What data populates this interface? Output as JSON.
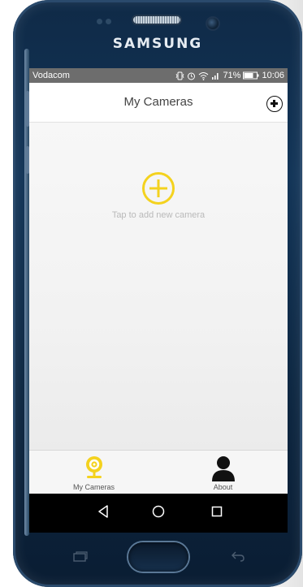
{
  "device": {
    "brand": "SAMSUNG"
  },
  "status_bar": {
    "carrier": "Vodacom",
    "battery": "71%",
    "time": "10:06"
  },
  "app_bar": {
    "title": "My Cameras",
    "add_icon": "plus-circle-icon"
  },
  "empty_state": {
    "icon": "plus-circle-icon",
    "text": "Tap to add new camera"
  },
  "tab_bar": {
    "tabs": [
      {
        "label": "My Cameras",
        "icon": "camera-icon",
        "active": true
      },
      {
        "label": "About",
        "icon": "person-icon",
        "active": false
      }
    ]
  },
  "nav_bar": {
    "back_icon": "back-triangle-icon",
    "home_icon": "home-circle-icon",
    "recents_icon": "recents-square-icon"
  },
  "colors": {
    "accent_yellow": "#f4d21e",
    "status_bar": "#6d6d6d",
    "nav_bar": "#000000"
  }
}
